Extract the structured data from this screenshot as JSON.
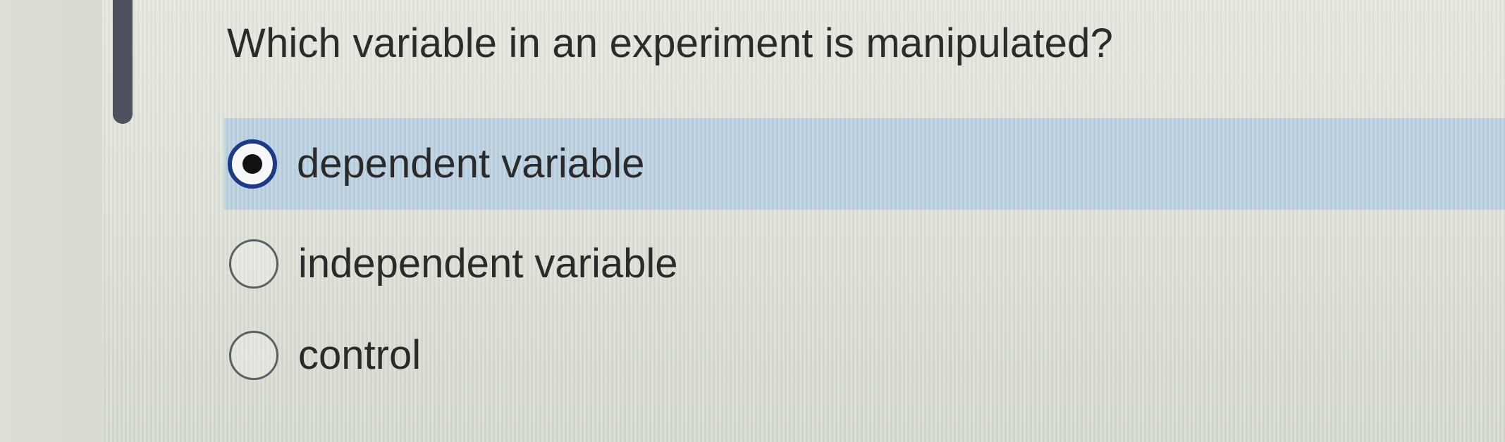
{
  "question": {
    "text": "Which variable in an experiment is manipulated?"
  },
  "options": [
    {
      "label": "dependent variable",
      "selected": true
    },
    {
      "label": "independent variable",
      "selected": false
    },
    {
      "label": "control",
      "selected": false
    }
  ],
  "colors": {
    "selected_highlight": "#b9cfdf",
    "radio_checked_border": "#1d3a8a",
    "focus_bar": "#4d525e",
    "text": "#2a2a2a"
  },
  "icons": {
    "radio_checked": "radio-selected-icon",
    "radio_unchecked": "radio-unselected-icon"
  }
}
